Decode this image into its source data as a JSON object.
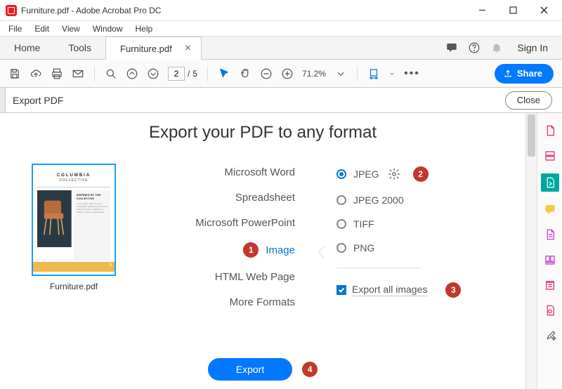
{
  "title": "Furniture.pdf - Adobe Acrobat Pro DC",
  "menu": {
    "file": "File",
    "edit": "Edit",
    "view": "View",
    "window": "Window",
    "help": "Help"
  },
  "tabs": {
    "home": "Home",
    "tools": "Tools",
    "doc": "Furniture.pdf"
  },
  "signin": "Sign In",
  "toolbar": {
    "page_current": "2",
    "page_sep": "/",
    "page_total": "5",
    "zoom": "71.2%",
    "share": "Share"
  },
  "panel": {
    "title": "Export PDF",
    "close": "Close"
  },
  "heading": "Export your PDF to any format",
  "thumb": {
    "brand": "COLUMBIA",
    "sub": "COLLECTIVE",
    "caption": "Furniture.pdf",
    "card_hdr": "INSPIRED BY THE COLLECTIVE"
  },
  "formats": {
    "word": "Microsoft Word",
    "spreadsheet": "Spreadsheet",
    "ppt": "Microsoft PowerPoint",
    "image": "Image",
    "html": "HTML Web Page",
    "more": "More Formats"
  },
  "image_opts": {
    "jpeg": "JPEG",
    "jpeg2000": "JPEG 2000",
    "tiff": "TIFF",
    "png": "PNG",
    "export_all": "Export all images"
  },
  "export_btn": "Export",
  "annotations": {
    "a1": "1",
    "a2": "2",
    "a3": "3",
    "a4": "4"
  }
}
